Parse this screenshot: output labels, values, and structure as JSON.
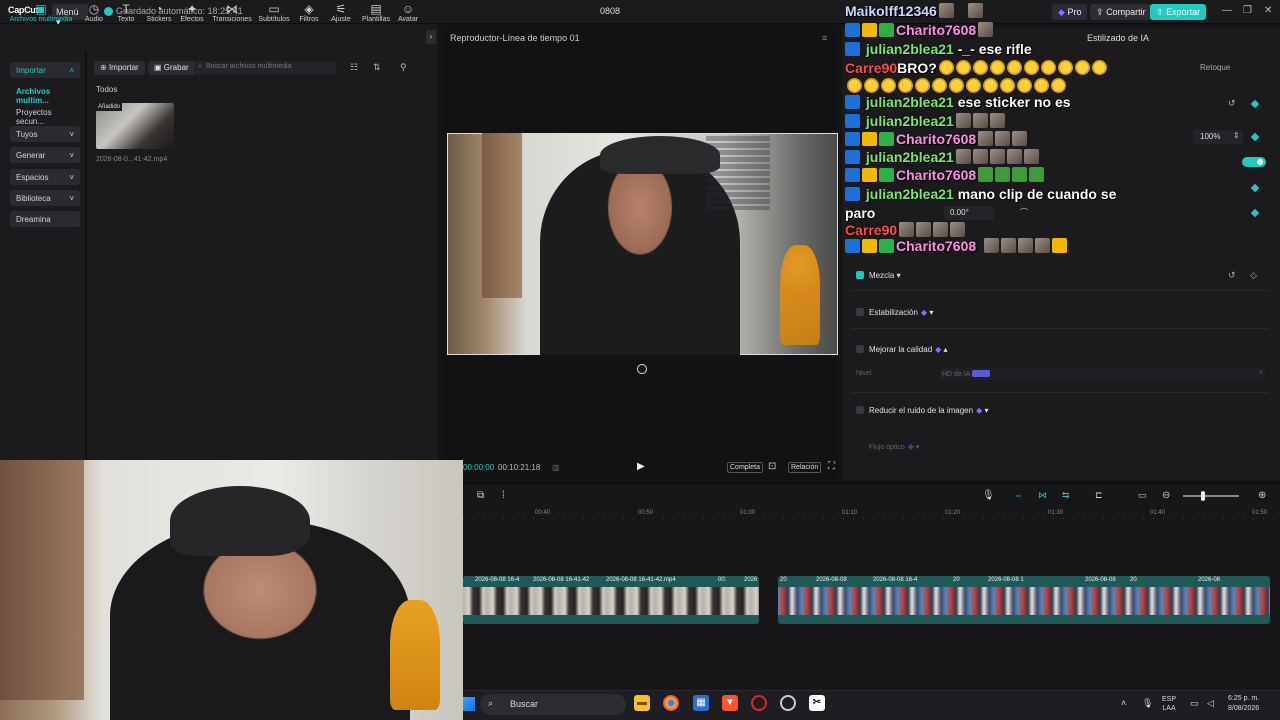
{
  "app": {
    "logo": "CapCut",
    "menu_label": "Menú",
    "autosave": "Guardado automático: 18:25:41",
    "project_name": "0808",
    "pro_label": "Pro",
    "share_label": "Compartir",
    "export_label": "Exportar"
  },
  "toolbar": {
    "items": [
      {
        "label": "Archivos multimedia",
        "icon": "media-icon"
      },
      {
        "label": "Audio",
        "icon": "audio-icon"
      },
      {
        "label": "Texto",
        "icon": "text-icon"
      },
      {
        "label": "Stickers",
        "icon": "sticker-icon"
      },
      {
        "label": "Efectos",
        "icon": "effects-icon"
      },
      {
        "label": "Transiciones",
        "icon": "transition-icon"
      },
      {
        "label": "Subtítulos",
        "icon": "subtitle-icon"
      },
      {
        "label": "Filtros",
        "icon": "filter-icon"
      },
      {
        "label": "Ajuste",
        "icon": "adjust-icon"
      },
      {
        "label": "Plantillas",
        "icon": "template-icon"
      },
      {
        "label": "Avatar",
        "icon": "avatar-icon"
      }
    ]
  },
  "leftnav": {
    "items": [
      "Importar",
      "Archivos multim...",
      "Proyectos secun...",
      "Tuyos",
      "Generar",
      "Espacios",
      "Biblioteca",
      "Dreamina"
    ]
  },
  "media": {
    "import_label": "Importar",
    "record_label": "Grabar",
    "search_placeholder": "Buscar archivos multimedia",
    "filter_label": "Todos",
    "thumb_badge": "Añadido",
    "thumb_name": "2026-08-0...41-42.mp4"
  },
  "player": {
    "title": "Reproductor-Línea de tiempo 01",
    "time_current": "00:00:00",
    "time_total": "00:10:21:18",
    "full_label": "Completa",
    "ratio_label": "Relación"
  },
  "rightpanel": {
    "tab_ai": "Estilizado de IA",
    "tab_retouch": "Retoque",
    "scale_value": "100%",
    "rotation_value": "0.00°",
    "mix_label": "Mezcla",
    "stabilize_label": "Estabilización",
    "quality_label": "Mejorar la calidad",
    "level_label": "Nivel",
    "level_value": "HD de IA",
    "noise_label": "Reducir el ruido de la imagen",
    "flow_label": "Flujo óptico"
  },
  "timeline": {
    "ticks": [
      "00:40",
      "00:50",
      "01:00",
      "01:10",
      "01:20",
      "01:30",
      "01:40",
      "01:50"
    ],
    "clip_labels_a": [
      "2026-08-08 16-4",
      "2026-08-08 16-41-42",
      "2026-08-08 16-41-42.mp4",
      "00:",
      "2026"
    ],
    "clip_labels_b": [
      "20",
      "2026-08-08",
      "2026-08-08 16-4",
      "20",
      "2026-08-08 1",
      "2026-08-08",
      "20",
      "2026-08"
    ]
  },
  "taskbar": {
    "search_label": "Buscar",
    "lang_1": "ESP",
    "lang_2": "LAA",
    "time": "6:25 p. m.",
    "date": "8/08/2026"
  },
  "chat": [
    {
      "user": "Maikolff12346",
      "text": "",
      "color": "#d0d7ff"
    },
    {
      "user": "Charito7608",
      "text": "",
      "color": "#ff8de0"
    },
    {
      "user": "julian2blea21",
      "text": "-_- ese rifle",
      "color": "#78e86b"
    },
    {
      "user": "Carre90",
      "text": "BRO?",
      "color": "#ff4a4a"
    },
    {
      "user": "julian2blea21",
      "text": "ese sticker no es",
      "color": "#78e86b"
    },
    {
      "user": "julian2blea21",
      "text": "",
      "color": "#78e86b"
    },
    {
      "user": "Charito7608",
      "text": "",
      "color": "#ff8de0"
    },
    {
      "user": "julian2blea21",
      "text": "",
      "color": "#78e86b"
    },
    {
      "user": "Charito7608",
      "text": "",
      "color": "#ff8de0"
    },
    {
      "user": "julian2blea21",
      "text": "mano clip de cuando se",
      "color": "#78e86b"
    },
    {
      "user": "",
      "text": "paro",
      "color": "#ffffff"
    },
    {
      "user": "Carre90",
      "text": "",
      "color": "#ff4a4a"
    },
    {
      "user": "Charito7608",
      "text": "",
      "color": "#ff8de0"
    }
  ]
}
